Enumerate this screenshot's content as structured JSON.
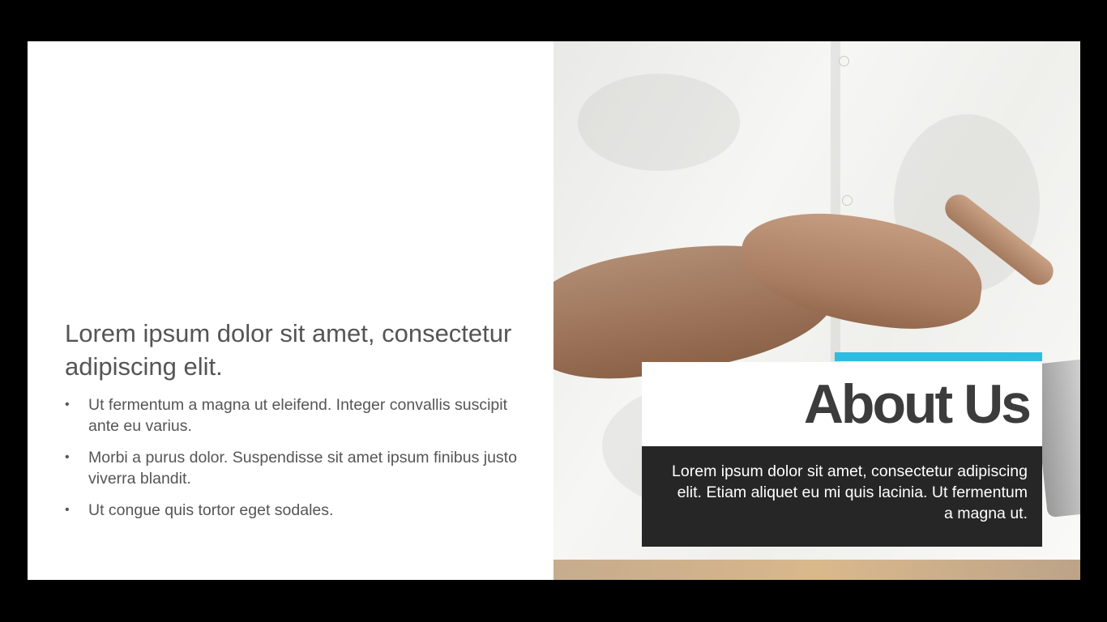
{
  "slide": {
    "heading": "Lorem ipsum dolor sit amet, consectetur adipiscing elit.",
    "bullets": [
      "Ut fermentum a magna ut eleifend. Integer convallis suscipit ante eu varius.",
      "Morbi a purus dolor. Suspendisse sit amet ipsum finibus justo viverra blandit.",
      "Ut congue quis tortor eget sodales."
    ],
    "bullet_glyph": "•",
    "title": "About Us",
    "description": "Lorem ipsum dolor sit amet, consectetur adipiscing elit. Etiam aliquet eu mi quis lacinia. Ut fermentum a magna ut."
  },
  "colors": {
    "accent": "#2ebde0",
    "dark_box": "#262626",
    "title_text": "#3c3c3c",
    "body_text": "#555555",
    "frame": "#000000"
  }
}
